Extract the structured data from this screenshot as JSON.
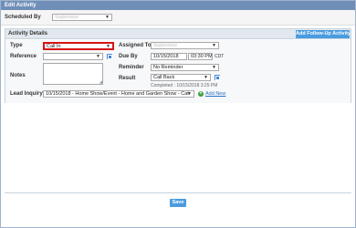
{
  "window": {
    "title": "Edit Activity"
  },
  "scheduled_by": {
    "label": "Scheduled By",
    "value": "Supervisor"
  },
  "activity_details": {
    "title": "Activity Details",
    "add_followup_label": "Add Follow-Up Activity",
    "type": {
      "label": "Type",
      "value": "Call In"
    },
    "reference": {
      "label": "Reference",
      "value": ""
    },
    "notes": {
      "label": "Notes",
      "value": ""
    },
    "lead_inquiry": {
      "label": "Lead Inquiry*",
      "value": "10/15/2018 - Home Show/Event - Home and Garden Show - Cat",
      "add_new_label": "Add New"
    },
    "assigned_to": {
      "label": "Assigned To",
      "value": "Supervisor"
    },
    "due_by": {
      "label": "Due By",
      "date": "10/15/2018",
      "time": "03:30 PM",
      "tz": "CDT"
    },
    "reminder": {
      "label": "Reminder",
      "value": "No Reminder"
    },
    "result": {
      "label": "Result",
      "value": "Call Back",
      "completed_text": "Completed : 10/15/2018 3:25 PM"
    }
  },
  "footer": {
    "save_label": "Save"
  },
  "colors": {
    "titlebar": "#6f8fb8",
    "accent": "#4a9ce0",
    "highlight": "#d61515"
  },
  "icons": {
    "select_arrow": "chevron-down-icon",
    "lookup": "lookup-icon",
    "result_detail": "detail-icon",
    "add_new": "plus-icon"
  }
}
